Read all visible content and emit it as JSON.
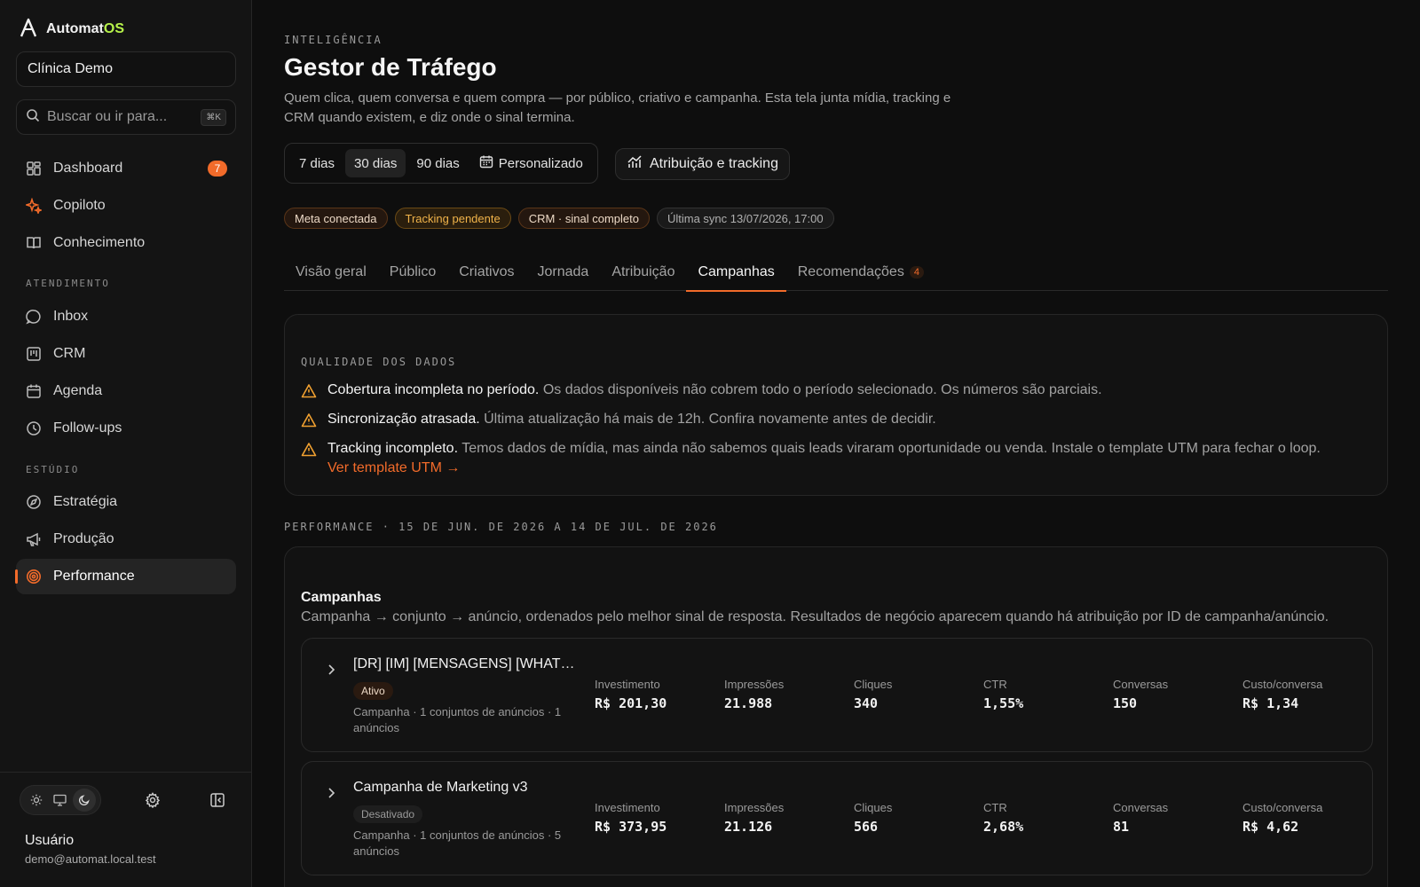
{
  "brand": {
    "name": "Automat",
    "suffix": "OS",
    "accent": "#b6f24a"
  },
  "workspace": {
    "name": "Clínica Demo"
  },
  "search": {
    "placeholder": "Buscar ou ir para...",
    "shortcut": "⌘K"
  },
  "nav": {
    "dashboard": {
      "label": "Dashboard",
      "badge": "7"
    },
    "copiloto": {
      "label": "Copiloto"
    },
    "conhecimento": {
      "label": "Conhecimento"
    },
    "section_atendimento": "ATENDIMENTO",
    "inbox": {
      "label": "Inbox"
    },
    "crm": {
      "label": "CRM"
    },
    "agenda": {
      "label": "Agenda"
    },
    "followups": {
      "label": "Follow-ups"
    },
    "section_estudio": "ESTÚDIO",
    "estrategia": {
      "label": "Estratégia"
    },
    "producao": {
      "label": "Produção"
    },
    "performance": {
      "label": "Performance"
    }
  },
  "user": {
    "name": "Usuário",
    "email": "demo@automat.local.test"
  },
  "page": {
    "eyebrow": "INTELIGÊNCIA",
    "title": "Gestor de Tráfego",
    "subtitle": "Quem clica, quem conversa e quem compra — por público, criativo e campanha. Esta tela junta mídia, tracking e CRM quando existem, e diz onde o sinal termina."
  },
  "range": {
    "options": [
      "7 dias",
      "30 dias",
      "90 dias"
    ],
    "selected": "30 dias",
    "custom": "Personalizado"
  },
  "attribution_button": "Atribuição e tracking",
  "pills": {
    "meta": "Meta conectada",
    "tracking": "Tracking pendente",
    "crm": "CRM · sinal completo",
    "sync": "Última sync 13/07/2026, 17:00"
  },
  "tabs": [
    "Visão geral",
    "Público",
    "Criativos",
    "Jornada",
    "Atribuição",
    "Campanhas",
    "Recomendações"
  ],
  "tab_active": "Campanhas",
  "tab_badge": "4",
  "quality": {
    "label": "QUALIDADE DOS DADOS",
    "items": [
      {
        "title": "Cobertura incompleta no período.",
        "desc": "Os dados disponíveis não cobrem todo o período selecionado. Os números são parciais."
      },
      {
        "title": "Sincronização atrasada.",
        "desc": "Última atualização há mais de 12h. Confira novamente antes de decidir."
      },
      {
        "title": "Tracking incompleto.",
        "desc": "Temos dados de mídia, mas ainda não sabemos quais leads viraram oportunidade ou venda. Instale o template UTM para fechar o loop."
      }
    ],
    "link": "Ver template UTM →"
  },
  "performance_label": "PERFORMANCE · 15 DE JUN. DE 2026 A 14 DE JUL. DE 2026",
  "campaigns": {
    "title": "Campanhas",
    "subtitle": "Campanha → conjunto → anúncio, ordenados pelo melhor sinal de resposta. Resultados de negócio aparecem quando há atribuição por ID de campanha/anúncio.",
    "metric_labels": [
      "Investimento",
      "Impressões",
      "Cliques",
      "CTR",
      "Conversas",
      "Custo/conversa"
    ],
    "rows": [
      {
        "name": "[DR] [IM] [MENSAGENS] [WHATSAPP]",
        "status": "Ativo",
        "meta": "Campanha · 1 conjuntos de anúncios · 1 anúncios",
        "values": [
          "R$ 201,30",
          "21.988",
          "340",
          "1,55%",
          "150",
          "R$ 1,34"
        ]
      },
      {
        "name": "Campanha de Marketing v3",
        "status": "Desativado",
        "meta": "Campanha · 1 conjuntos de anúncios · 5 anúncios",
        "values": [
          "R$ 373,95",
          "21.126",
          "566",
          "2,68%",
          "81",
          "R$ 4,62"
        ]
      }
    ]
  },
  "colors": {
    "accent": "#f26b2a",
    "warning": "#f0a030",
    "background": "#0e0e0e"
  }
}
